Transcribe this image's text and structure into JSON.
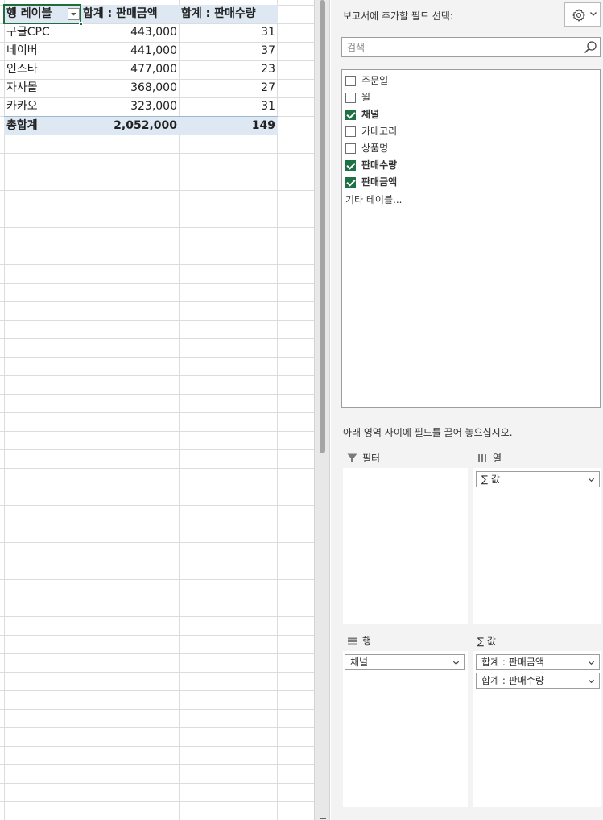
{
  "pivot": {
    "header": {
      "row_label": "행 레이블",
      "sum_amount": "합계 : 판매금액",
      "sum_qty": "합계 : 판매수량"
    },
    "rows": [
      {
        "channel": "구글CPC",
        "amount": "443,000",
        "qty": "31"
      },
      {
        "channel": "네이버",
        "amount": "441,000",
        "qty": "37"
      },
      {
        "channel": "인스타",
        "amount": "477,000",
        "qty": "23"
      },
      {
        "channel": "자사몰",
        "amount": "368,000",
        "qty": "27"
      },
      {
        "channel": "카카오",
        "amount": "323,000",
        "qty": "31"
      }
    ],
    "total": {
      "label": "총합계",
      "amount": "2,052,000",
      "qty": "149"
    }
  },
  "field_list": {
    "title": "보고서에 추가할 필드 선택:",
    "search_placeholder": "검색",
    "fields": [
      {
        "label": "주문일",
        "checked": false
      },
      {
        "label": "월",
        "checked": false
      },
      {
        "label": "채널",
        "checked": true
      },
      {
        "label": "카테고리",
        "checked": false
      },
      {
        "label": "상품명",
        "checked": false
      },
      {
        "label": "판매수량",
        "checked": true
      },
      {
        "label": "판매금액",
        "checked": true
      }
    ],
    "more_tables": "기타 테이블...",
    "areas_hint": "아래 영역 사이에 필드를 끌어 놓으십시오.",
    "areas": {
      "filter": {
        "title": "필터"
      },
      "columns": {
        "title": "열",
        "items": [
          "∑ 값"
        ]
      },
      "rows": {
        "title": "행",
        "items": [
          "채널"
        ]
      },
      "values": {
        "title": "∑ 값",
        "items": [
          "합계 : 판매금액",
          "합계 : 판매수량"
        ]
      }
    }
  },
  "colors": {
    "excel_green": "#1e7145",
    "pivot_header_bg": "#dde8f3",
    "pane_bg": "#f3f3f3"
  },
  "icons": [
    "gear-icon",
    "search-icon",
    "filter-icon",
    "columns-icon",
    "rows-icon",
    "chevron-down-icon",
    "checkbox-icon"
  ]
}
